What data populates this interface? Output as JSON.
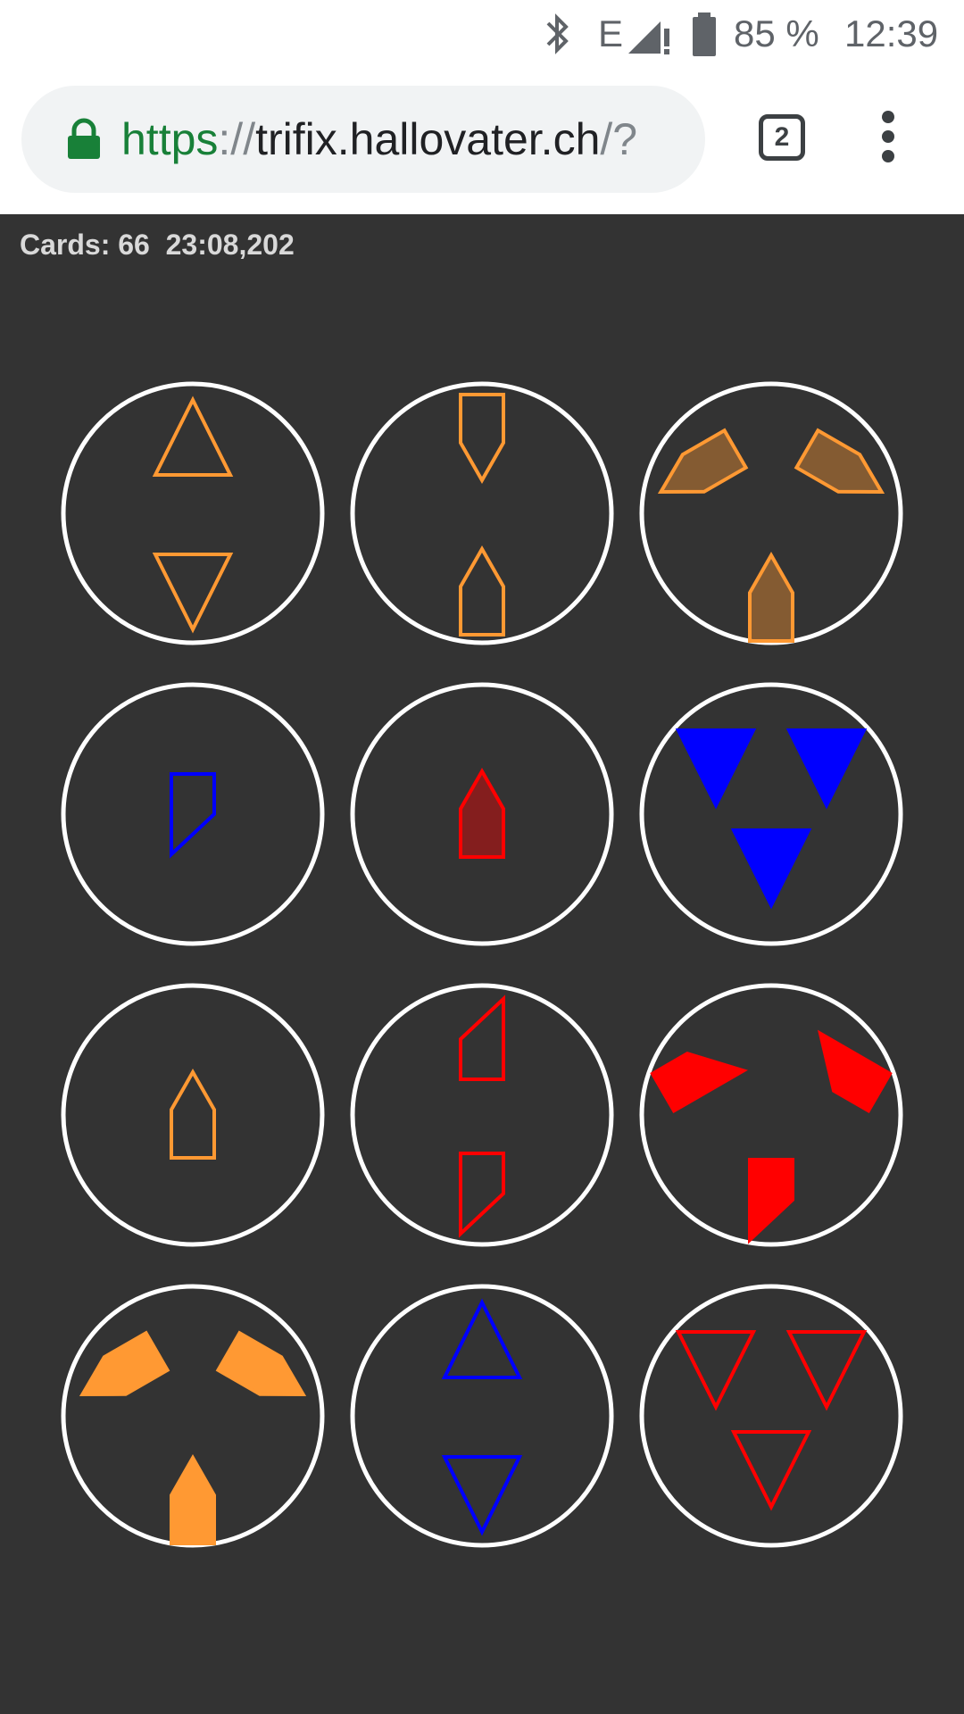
{
  "status_bar": {
    "battery_percent": "85 %",
    "time": "12:39",
    "network_type": "E",
    "icons": [
      "bluetooth-icon",
      "signal-icon",
      "battery-icon"
    ]
  },
  "browser": {
    "url_scheme": "https",
    "url_separator": "://",
    "url_host": "trifix.hallovater.ch",
    "url_rest": "/?",
    "tab_count": "2",
    "icons": [
      "lock-icon",
      "menu-icon"
    ]
  },
  "game": {
    "cards_label": "Cards:",
    "cards_count": "66",
    "timer": "23:08,202",
    "colors": {
      "background": "#333333",
      "card_border": "#ffffff",
      "orange": "#ff9933",
      "blue": "#0000ff",
      "red": "#ff0000"
    },
    "cards": [
      {
        "count": 2,
        "shape": "triangle",
        "color": "orange",
        "fill": "empty"
      },
      {
        "count": 2,
        "shape": "arrow",
        "color": "orange",
        "fill": "empty"
      },
      {
        "count": 3,
        "shape": "arrow",
        "color": "orange",
        "fill": "shaded"
      },
      {
        "count": 1,
        "shape": "notch",
        "color": "blue",
        "fill": "empty"
      },
      {
        "count": 1,
        "shape": "arrow",
        "color": "red",
        "fill": "shaded"
      },
      {
        "count": 3,
        "shape": "triangle",
        "color": "blue",
        "fill": "solid"
      },
      {
        "count": 1,
        "shape": "arrow",
        "color": "orange",
        "fill": "empty"
      },
      {
        "count": 2,
        "shape": "notch",
        "color": "red",
        "fill": "empty"
      },
      {
        "count": 3,
        "shape": "notch",
        "color": "red",
        "fill": "solid"
      },
      {
        "count": 3,
        "shape": "arrow",
        "color": "orange",
        "fill": "solid"
      },
      {
        "count": 2,
        "shape": "triangle",
        "color": "blue",
        "fill": "empty"
      },
      {
        "count": 3,
        "shape": "triangle",
        "color": "red",
        "fill": "empty"
      }
    ]
  }
}
